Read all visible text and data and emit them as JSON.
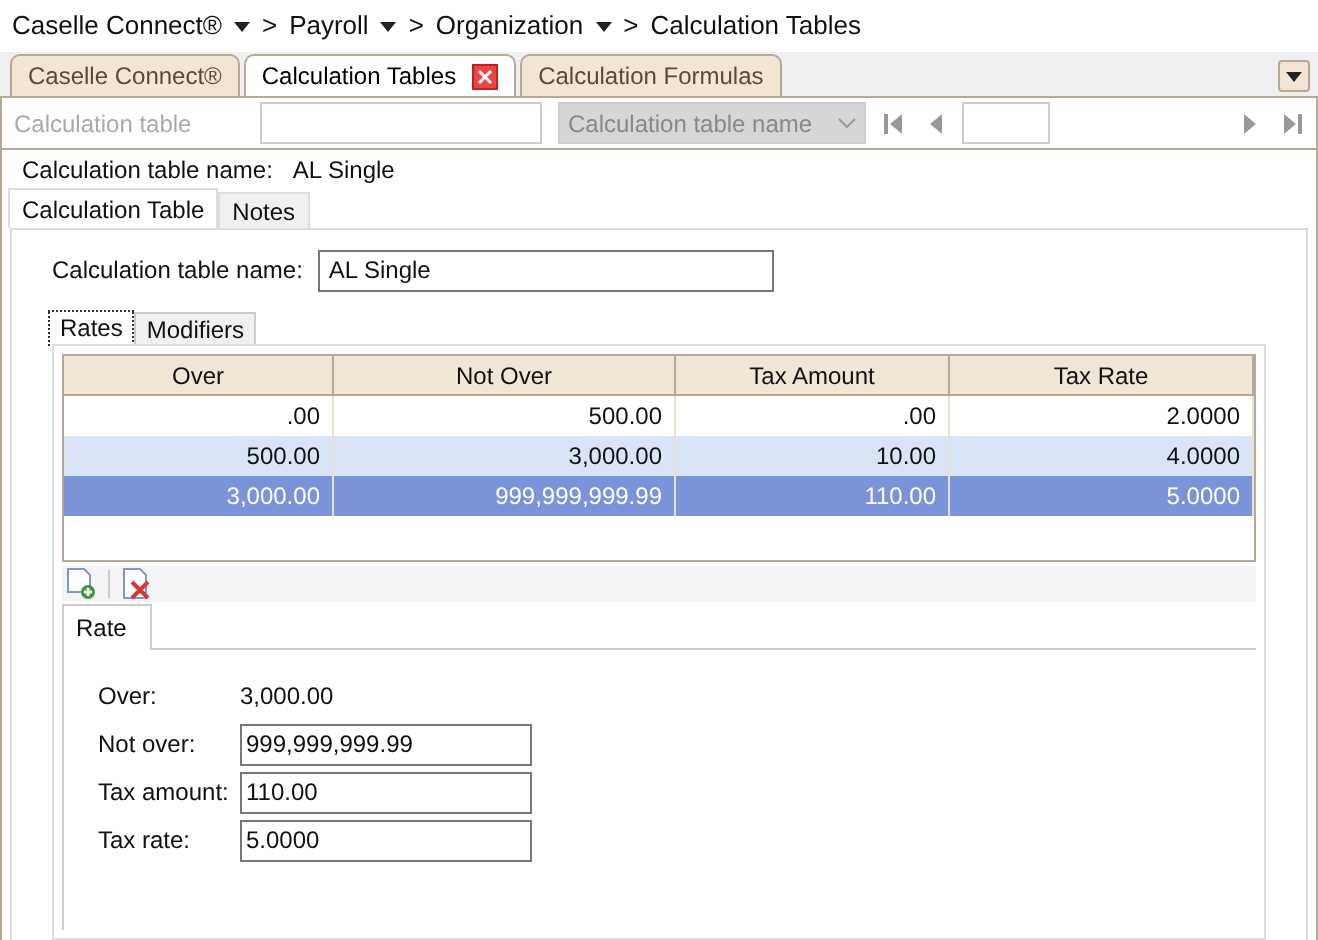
{
  "breadcrumbs": [
    {
      "label": "Caselle Connect®",
      "has_menu": true,
      "separator": ">"
    },
    {
      "label": "Payroll",
      "has_menu": true,
      "separator": ">"
    },
    {
      "label": "Organization",
      "has_menu": true,
      "separator": ">"
    },
    {
      "label": "Calculation Tables",
      "has_menu": false
    }
  ],
  "tabs": [
    {
      "label": "Caselle Connect®",
      "selected": false,
      "closable": false
    },
    {
      "label": "Calculation Tables",
      "selected": true,
      "closable": true
    },
    {
      "label": "Calculation Formulas",
      "selected": false,
      "closable": false
    }
  ],
  "toolbar": {
    "lookup_label": "Calculation table",
    "lookup_disabled": true,
    "name_dropdown": {
      "placeholder": "Calculation table name",
      "disabled": true
    }
  },
  "header": {
    "label": "Calculation table name:",
    "value": "AL Single"
  },
  "section_tabs": [
    {
      "label": "Calculation Table",
      "selected": true
    },
    {
      "label": "Notes",
      "selected": false
    }
  ],
  "name_field": {
    "label": "Calculation table name:",
    "value": "AL Single"
  },
  "grid_tabs": [
    {
      "label": "Rates",
      "selected": true
    },
    {
      "label": "Modifiers",
      "selected": false
    }
  ],
  "table": {
    "columns": [
      "Over",
      "Not Over",
      "Tax Amount",
      "Tax Rate"
    ],
    "rows": [
      {
        "cells": [
          ".00",
          "500.00",
          ".00",
          "2.0000"
        ],
        "selected": false
      },
      {
        "cells": [
          "500.00",
          "3,000.00",
          "10.00",
          "4.0000"
        ],
        "selected": false
      },
      {
        "cells": [
          "3,000.00",
          "999,999,999.99",
          "110.00",
          "5.0000"
        ],
        "selected": true
      }
    ]
  },
  "detail_tab": "Rate",
  "detail": [
    {
      "kind": "text",
      "label": "Over:",
      "value": "3,000.00"
    },
    {
      "kind": "field",
      "label": "Not over:",
      "value": "999,999,999.99"
    },
    {
      "kind": "field",
      "label": "Tax amount:",
      "value": "110.00"
    },
    {
      "kind": "field",
      "label": "Tax rate:",
      "value": "5.0000"
    }
  ]
}
